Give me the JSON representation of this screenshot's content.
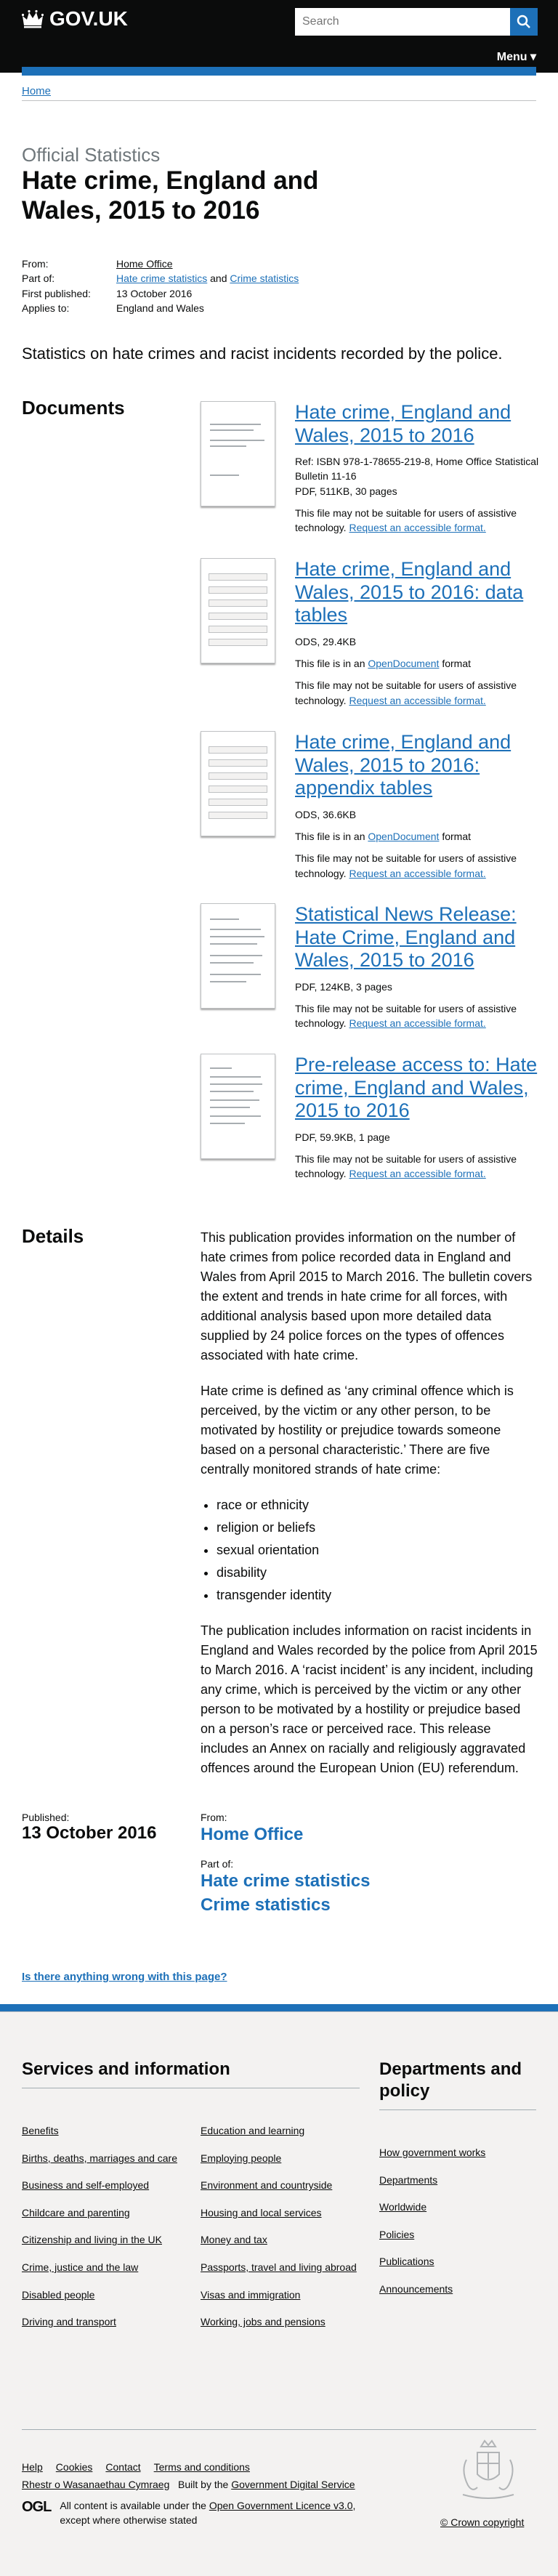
{
  "header": {
    "logo_text": "GOV.UK",
    "search_placeholder": "Search",
    "menu_label": "Menu",
    "menu_arrow": "▾"
  },
  "breadcrumb": {
    "home": "Home"
  },
  "document": {
    "type": "Official Statistics",
    "title": "Hate crime, England and Wales, 2015 to 2016",
    "metadata": {
      "from_label": "From:",
      "from_value": "Home Office",
      "part_of_label": "Part of:",
      "part_of_values": [
        "Hate crime statistics",
        "Crime statistics"
      ],
      "part_of_joiner": "and",
      "first_published_label": "First published:",
      "first_published_value": "13 October 2016",
      "applies_to_label": "Applies to:",
      "applies_to_value": "England and Wales"
    },
    "summary": "Statistics on hate crimes and racist incidents recorded by the police."
  },
  "documents": {
    "heading": "Documents",
    "items": [
      {
        "title": "Hate crime, England and Wales, 2015 to 2016",
        "meta": "Ref: ISBN 978-1-78655-219-8, Home Office Statistical Bulletin 11-16",
        "meta2": "PDF, 511KB, 30 pages",
        "note": "This file may not be suitable for users of assistive technology.",
        "request_link": "Request an accessible format."
      },
      {
        "title": "Hate crime, England and Wales, 2015 to 2016: data tables",
        "meta": "ODS, 29.4KB",
        "opendoc_prefix": "This file is in an",
        "opendoc_link": "OpenDocument",
        "opendoc_suffix": "format",
        "note": "This file may not be suitable for users of assistive technology.",
        "request_link": "Request an accessible format."
      },
      {
        "title": "Hate crime, England and Wales, 2015 to 2016: appendix tables",
        "meta": "ODS, 36.6KB",
        "opendoc_prefix": "This file is in an",
        "opendoc_link": "OpenDocument",
        "opendoc_suffix": "format",
        "note": "This file may not be suitable for users of assistive technology.",
        "request_link": "Request an accessible format."
      },
      {
        "title": "Statistical News Release: Hate Crime, England and Wales, 2015 to 2016",
        "meta": "PDF, 124KB, 3 pages",
        "note": "This file may not be suitable for users of assistive technology.",
        "request_link": "Request an accessible format."
      },
      {
        "title": "Pre-release access to: Hate crime, England and Wales, 2015 to 2016",
        "meta": "PDF, 59.9KB, 1 page",
        "note": "This file may not be suitable for users of assistive technology.",
        "request_link": "Request an accessible format."
      }
    ]
  },
  "details": {
    "heading": "Details",
    "p1": "This publication provides information on the number of hate crimes from police recorded data in England and Wales from April 2015 to March 2016. The bulletin covers the extent and trends in hate crime for all forces, with additional analysis based upon more detailed data supplied by 24 police forces on the types of offences associated with hate crime.",
    "p2": "Hate crime is defined as ‘any criminal offence which is perceived, by the victim or any other person, to be motivated by hostility or prejudice towards someone based on a personal characteristic.’ There are five centrally monitored strands of hate crime:",
    "strands": [
      "race or ethnicity",
      "religion or beliefs",
      "sexual orientation",
      "disability",
      "transgender identity"
    ],
    "p3": "The publication includes information on racist incidents in England and Wales recorded by the police from April 2015 to March 2016. A ‘racist incident’ is any incident, including any crime, which is perceived by the victim or any other person to be motivated by a hostility or prejudice based on a person’s race or perceived race. This release includes an Annex on racially and religiously aggravated offences around the European Union (EU) referendum."
  },
  "published": {
    "published_label": "Published:",
    "published_value": "13 October 2016",
    "from_label": "From:",
    "from_value": "Home Office",
    "part_of_label": "Part of:",
    "part_of_values": [
      "Hate crime statistics",
      "Crime statistics"
    ]
  },
  "report_link": "Is there anything wrong with this page?",
  "footer": {
    "services_heading": "Services and information",
    "departments_heading": "Departments and policy",
    "services_col1": [
      "Benefits",
      "Births, deaths, marriages and care",
      "Business and self-employed",
      "Childcare and parenting",
      "Citizenship and living in the UK",
      "Crime, justice and the law",
      "Disabled people",
      "Driving and transport"
    ],
    "services_col2": [
      "Education and learning",
      "Employing people",
      "Environment and countryside",
      "Housing and local services",
      "Money and tax",
      "Passports, travel and living abroad",
      "Visas and immigration",
      "Working, jobs and pensions"
    ],
    "departments": [
      "How government works",
      "Departments",
      "Worldwide",
      "Policies",
      "Publications",
      "Announcements"
    ],
    "meta_links": [
      "Help",
      "Cookies",
      "Contact",
      "Terms and conditions",
      "Rhestr o Wasanaethau Cymraeg"
    ],
    "built_by_prefix": "Built by the",
    "built_by_link": "Government Digital Service",
    "ogl_logo": "OGL",
    "licence_prefix": "All content is available under the",
    "licence_link": "Open Government Licence v3.0",
    "licence_suffix": ", except where otherwise stated",
    "copyright": "© Crown copyright"
  },
  "colors": {
    "link": "#1d70b8",
    "header": "#0b0c0c",
    "footer_bg": "#f3f2f1"
  }
}
